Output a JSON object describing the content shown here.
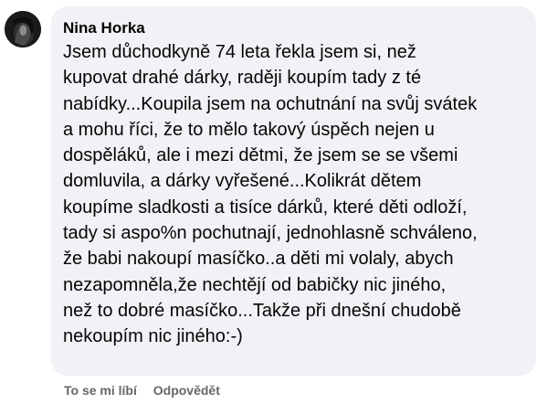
{
  "comment": {
    "author": "Nina Horka",
    "text_lines": [
      "Jsem důchodkyně 74 leta řekla jsem si, než",
      "kupovat drahé dárky, raději koupím tady z té",
      "nabídky...Koupila jsem na ochutnání na svůj svátek",
      "a mohu říci, že to mělo takový úspěch nejen u",
      "dospěláků, ale i mezi dětmi, že jsem se se všemi",
      "domluvila, a dárky vyřešené...Kolikrát dětem",
      "koupíme sladkosti a tisíce dárků, které děti odloží,",
      "tady si aspo%n pochutnají, jednohlasně schváleno,",
      "že babi nakoupí masíčko..a děti mi volaly, abych",
      "nezapomněla,že nechtějí od babičky nic jiného,",
      "než to dobré masíčko...Takže při dnešní chudobě",
      "nekoupím nic jiného:-)"
    ]
  },
  "actions": {
    "like_label": "To se mi líbí",
    "reply_label": "Odpovědět"
  },
  "colors": {
    "bubble_background": "#f0f2f5",
    "action_text": "#65676b",
    "body_text": "#050505"
  },
  "icons": {
    "avatar": "profile-photo"
  }
}
